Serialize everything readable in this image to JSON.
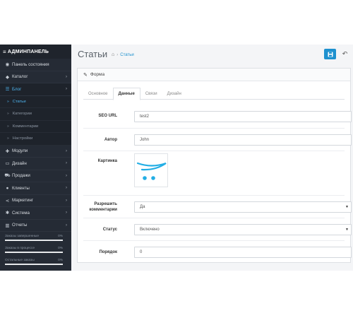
{
  "sidebar": {
    "brand": "АДМИНПАНЕЛЬ",
    "items": [
      {
        "label": "Панель состояния",
        "icon": "dashboard-icon",
        "glyph": "◉",
        "chevron": false
      },
      {
        "label": "Каталог",
        "icon": "tag-icon",
        "glyph": "◆",
        "chevron": true
      },
      {
        "label": "Блог",
        "icon": "list-icon",
        "glyph": "☰",
        "chevron": true,
        "active": true
      }
    ],
    "submenu": [
      {
        "label": "Статьи",
        "active": true
      },
      {
        "label": "Категории"
      },
      {
        "label": "Комментарии"
      },
      {
        "label": "Настройки"
      }
    ],
    "items2": [
      {
        "label": "Модули",
        "icon": "puzzle-icon",
        "glyph": "✚"
      },
      {
        "label": "Дизайн",
        "icon": "monitor-icon",
        "glyph": "▭"
      },
      {
        "label": "Продажи",
        "icon": "cart-icon",
        "glyph": "⛟"
      },
      {
        "label": "Клиенты",
        "icon": "user-icon",
        "glyph": "●"
      },
      {
        "label": "Маркетинг",
        "icon": "share-icon",
        "glyph": "⋖"
      },
      {
        "label": "Система",
        "icon": "gear-icon",
        "glyph": "✱"
      },
      {
        "label": "Отчеты",
        "icon": "bar-chart-icon",
        "glyph": "▥"
      }
    ],
    "stats": [
      {
        "label": "Заказы завершенные",
        "value": "0%"
      },
      {
        "label": "Заказы в процессе",
        "value": "0%"
      },
      {
        "label": "Остальные заказы",
        "value": "0%"
      }
    ]
  },
  "header": {
    "title": "Статьи",
    "breadcrumb": "Статьи"
  },
  "panel": {
    "title": "Форма",
    "tabs": [
      "Основное",
      "Данные",
      "Связи",
      "Дизайн"
    ],
    "active_tab": "Данные",
    "fields": {
      "seo_label": "SEO URL",
      "seo_value": "test2",
      "author_label": "Автор",
      "author_value": "John",
      "image_label": "Картинка",
      "comments_label": "Разрешить комментарии",
      "comments_value": "Да",
      "status_label": "Статус",
      "status_value": "Включено",
      "order_label": "Порядок",
      "order_value": "0"
    }
  },
  "colors": {
    "sidebar_bg": "#252b35",
    "accent": "#1e91cf",
    "active_link": "#4fb6f1"
  }
}
